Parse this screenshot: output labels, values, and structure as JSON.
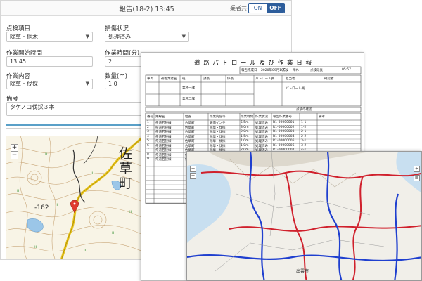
{
  "report": {
    "title": "報告(18-2) 13:45",
    "share_label": "業者共有",
    "toggle_on": "ON",
    "toggle_off": "OFF",
    "fields": {
      "inspection_item": {
        "label": "点検項目",
        "value": "除草・個木"
      },
      "damage_status": {
        "label": "損傷状況",
        "value": "処理済み"
      },
      "work_start_time": {
        "label": "作業開始時間",
        "value": "13:45"
      },
      "work_duration": {
        "label": "作業時間(分)",
        "value": "2"
      },
      "work_content": {
        "label": "作業内容",
        "value": "除草・伐採"
      },
      "quantity": {
        "label": "数量(m)",
        "value": "1.0"
      },
      "remarks": {
        "label": "備考",
        "value": "タケノコ伐採３本"
      }
    },
    "map": {
      "town_label": "佐\n草\n町",
      "elevation_label": "-162",
      "zoom_in": "+",
      "zoom_out": "−"
    }
  },
  "patrol_doc": {
    "peek_text": "報告(18-2) 13:45",
    "title": "道 路 パ ト ロ ー ル 及 び 作 業 日 報",
    "header_cells": [
      "報告作成日",
      "2020年09月10日",
      "天候",
      "晴れ",
      "点検延長",
      "05:57"
    ],
    "section_labels": [
      "車両",
      "補佐業者名",
      "班",
      "課長",
      "係長",
      "パトロール員",
      "担当者",
      "確認者"
    ],
    "row_labels": [
      "業務一課",
      "業務二課"
    ],
    "patrol_label": "パトロール員",
    "checker_label": "点検の確認",
    "table_headers": [
      "番号",
      "路線名",
      "位置",
      "作業内容等",
      "作業時間",
      "作業状況",
      "報告作業番号",
      "備考"
    ],
    "rows": [
      [
        "1",
        "県道若狭線",
        "佐草町",
        "路面インチ",
        "5.5m",
        "処理済み",
        "R1-00000001",
        "1-1"
      ],
      [
        "2",
        "県道若狭線",
        "佐草町",
        "除草・伐採",
        "3.0m",
        "処理済み",
        "R1-00000002",
        "1-2"
      ],
      [
        "3",
        "県道若狭線",
        "佐草町",
        "除草・伐採",
        "2.0m",
        "処理済み",
        "R1-00000003",
        "2-1"
      ],
      [
        "4",
        "県道若狭線",
        "佐草町",
        "除草・伐採",
        "1.5m",
        "処理済み",
        "R1-00000004",
        "2-2"
      ],
      [
        "5",
        "県道若狭線",
        "佐草町",
        "除草・伐採",
        "1.0m",
        "処理済み",
        "R1-00000005",
        "3-1"
      ],
      [
        "6",
        "県道若狭線",
        "佐草町",
        "除草・伐採",
        "1.0m",
        "処理済み",
        "R1-00000006",
        "3-2"
      ],
      [
        "7",
        "県道若狭線",
        "佐草町",
        "除草・伐採",
        "2.0m",
        "処理済み",
        "R1-00000007",
        "4-1"
      ],
      [
        "8",
        "県道若狭線",
        "佐草町",
        "除草・伐採",
        "1.0m",
        "処理済み",
        "R1-00000008",
        "4-2"
      ],
      [
        "9",
        "県道若狭線",
        "佐草町",
        "除草・伐採",
        "1.0m",
        "処理済み",
        "R1-00000009",
        "5-1"
      ]
    ]
  },
  "road_map": {
    "city_label": "出雲市",
    "controls": [
      "+",
      "−"
    ]
  },
  "colors": {
    "accent": "#2d5d9b",
    "road_red": "#d0202c",
    "road_blue": "#1f3fcf",
    "water": "#c8dff0",
    "topo_bg": "#f8f4e6"
  }
}
